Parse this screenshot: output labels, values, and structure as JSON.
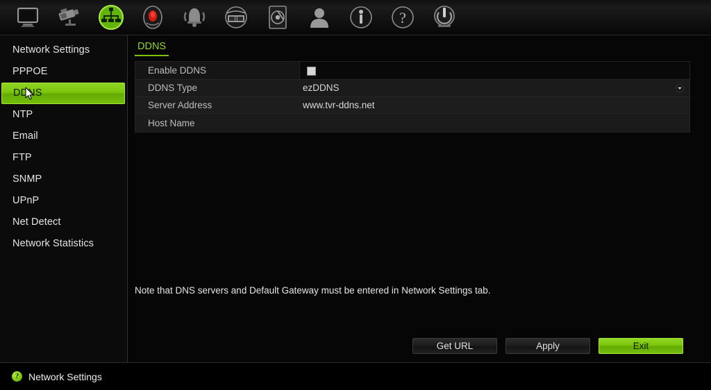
{
  "toolbar": {
    "items": [
      {
        "name": "display-icon",
        "title": "Display",
        "active": false
      },
      {
        "name": "camera-icon",
        "title": "Camera",
        "active": false
      },
      {
        "name": "network-icon",
        "title": "Network",
        "active": true
      },
      {
        "name": "record-icon",
        "title": "Record",
        "active": false
      },
      {
        "name": "alarm-icon",
        "title": "Alarm",
        "active": false
      },
      {
        "name": "playback-icon",
        "title": "Playback",
        "active": false
      },
      {
        "name": "hdd-icon",
        "title": "HDD",
        "active": false
      },
      {
        "name": "user-icon",
        "title": "User",
        "active": false
      },
      {
        "name": "info-icon",
        "title": "Info",
        "active": false
      },
      {
        "name": "help-icon",
        "title": "Help",
        "active": false
      },
      {
        "name": "power-icon",
        "title": "Shutdown",
        "active": false
      }
    ]
  },
  "sidebar": {
    "items": [
      {
        "label": "Network Settings",
        "active": false
      },
      {
        "label": "PPPOE",
        "active": false
      },
      {
        "label": "DDNS",
        "active": true
      },
      {
        "label": "NTP",
        "active": false
      },
      {
        "label": "Email",
        "active": false
      },
      {
        "label": "FTP",
        "active": false
      },
      {
        "label": "SNMP",
        "active": false
      },
      {
        "label": "UPnP",
        "active": false
      },
      {
        "label": "Net Detect",
        "active": false
      },
      {
        "label": "Network Statistics",
        "active": false
      }
    ]
  },
  "main": {
    "tab": "DDNS",
    "form": {
      "rows": [
        {
          "label": "Enable DDNS",
          "value": "",
          "control": "checkbox"
        },
        {
          "label": "DDNS Type",
          "value": "ezDDNS",
          "control": "dropdown"
        },
        {
          "label": "Server Address",
          "value": "www.tvr-ddns.net",
          "control": "text"
        },
        {
          "label": "Host Name",
          "value": "",
          "control": "text"
        }
      ],
      "enable_ddns_checked": false
    },
    "note": "Note that DNS servers and Default Gateway must be entered in Network Settings tab.",
    "buttons": [
      {
        "label": "Get URL",
        "style": "dark"
      },
      {
        "label": "Apply",
        "style": "dark"
      },
      {
        "label": "Exit",
        "style": "green"
      }
    ]
  },
  "statusbar": {
    "help_glyph": "?",
    "text": "Network Settings"
  },
  "colors": {
    "accent_green": "#7cc40c",
    "accent_green_light": "#8fd623",
    "panel_bg": "#1b1b1b",
    "window_bg": "#060606",
    "text_primary": "#e4e4e4",
    "text_secondary": "#bdbdbd"
  }
}
